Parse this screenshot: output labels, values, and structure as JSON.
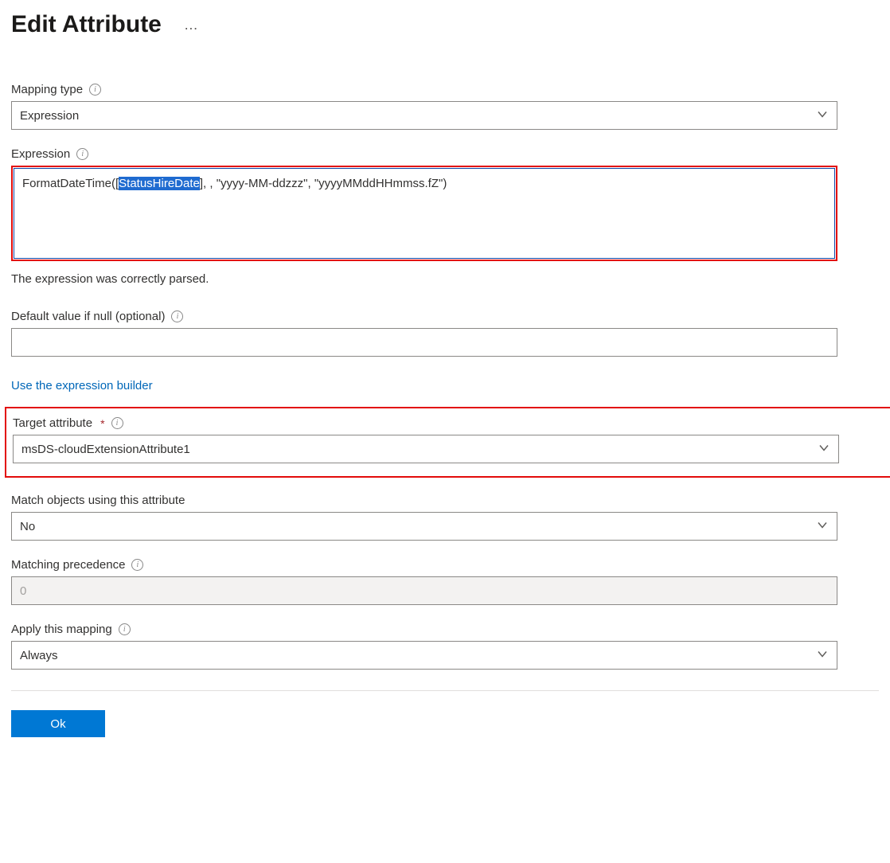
{
  "header": {
    "title": "Edit Attribute"
  },
  "mappingType": {
    "label": "Mapping type",
    "value": "Expression"
  },
  "expression": {
    "label": "Expression",
    "prefix": "FormatDateTime([",
    "selected": "StatusHireDate",
    "suffix": "], , \"yyyy-MM-ddzzz\", \"yyyyMMddHHmmss.fZ\")",
    "statusMessage": "The expression was correctly parsed."
  },
  "defaultVal": {
    "label": "Default value if null (optional)",
    "value": ""
  },
  "links": {
    "exprBuilder": "Use the expression builder"
  },
  "targetAttr": {
    "label": "Target attribute",
    "value": "msDS-cloudExtensionAttribute1"
  },
  "matchObjects": {
    "label": "Match objects using this attribute",
    "value": "No"
  },
  "matchPrecedence": {
    "label": "Matching precedence",
    "value": "0"
  },
  "applyMapping": {
    "label": "Apply this mapping",
    "value": "Always"
  },
  "footer": {
    "okLabel": "Ok"
  }
}
